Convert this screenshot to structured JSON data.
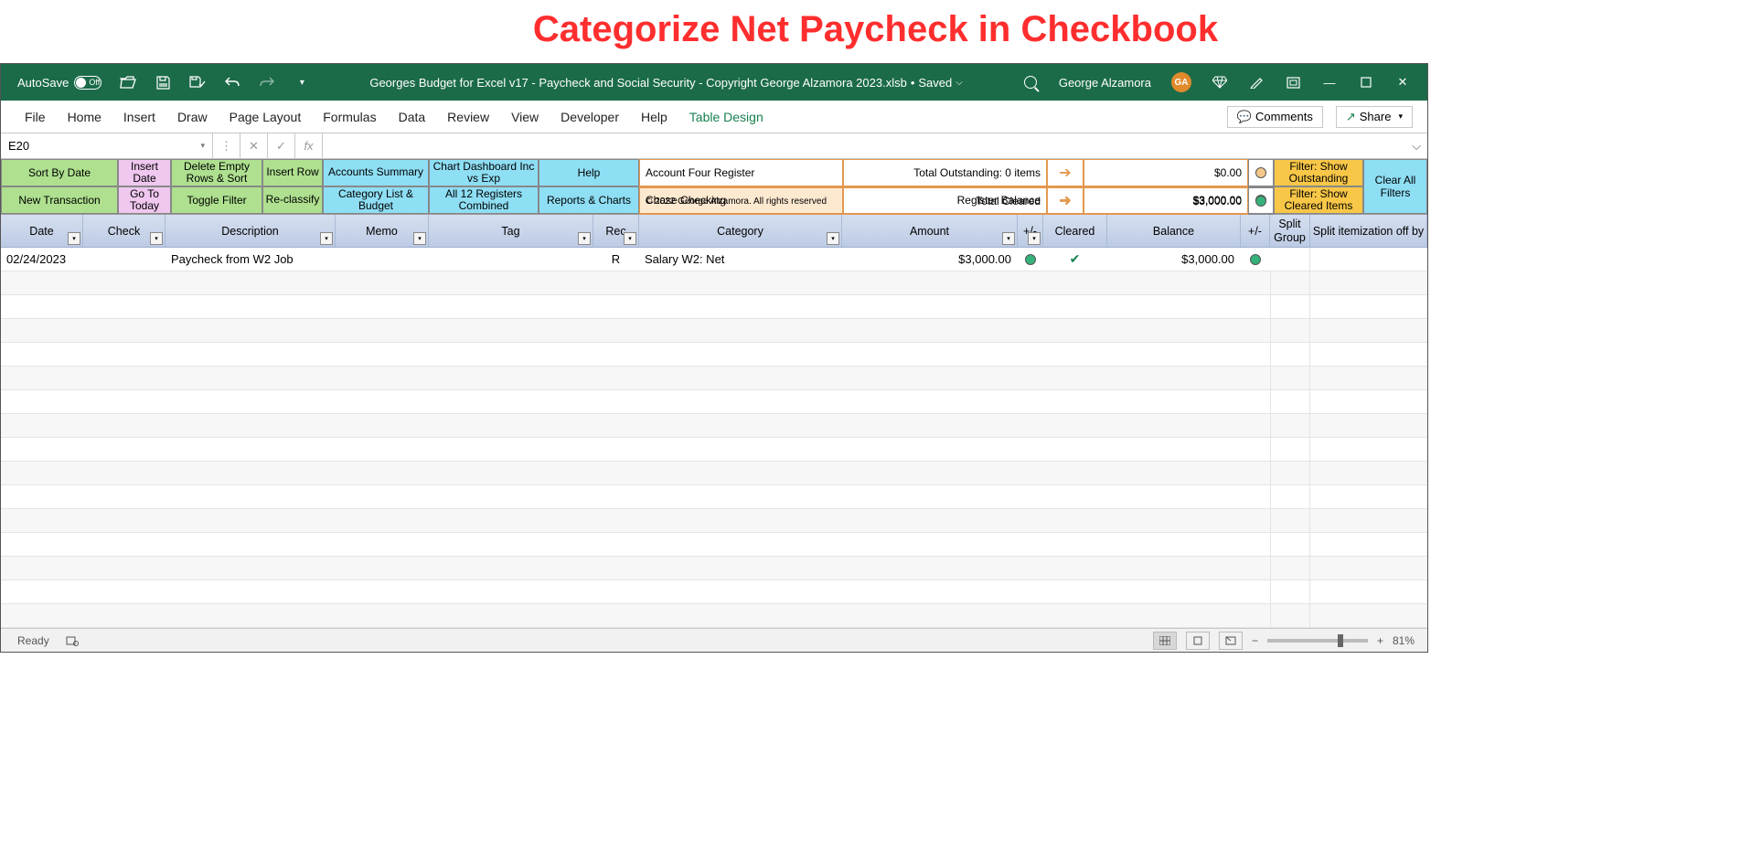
{
  "page_heading": "Categorize Net Paycheck in Checkbook",
  "titlebar": {
    "autosave": "AutoSave",
    "autosave_state": "Off",
    "filename": "Georges Budget for Excel v17 - Paycheck and Social Security - Copyright George Alzamora 2023.xlsb",
    "save_state": "Saved",
    "user": "George Alzamora",
    "initials": "GA"
  },
  "ribbon": {
    "tabs": [
      "File",
      "Home",
      "Insert",
      "Draw",
      "Page Layout",
      "Formulas",
      "Data",
      "Review",
      "View",
      "Developer",
      "Help",
      "Table Design"
    ],
    "comments": "Comments",
    "share": "Share"
  },
  "fbar": {
    "namebox": "E20",
    "fx": "fx"
  },
  "ctool": {
    "sort_by_date": "Sort By Date",
    "new_transaction": "New Transaction",
    "insert_date": "Insert Date",
    "go_to_today": "Go To Today",
    "delete_empty": "Delete Empty Rows & Sort",
    "toggle_filter": "Toggle Filter",
    "insert_row": "Insert Row",
    "reclassify": "Re-classify",
    "accounts_summary": "Accounts Summary",
    "category_list": "Category List & Budget",
    "chart_dashboard": "Chart Dashboard Inc vs Exp",
    "all12": "All 12 Registers Combined",
    "help": "Help",
    "reports": "Reports & Charts",
    "filter_outstanding": "Filter: Show Outstanding",
    "filter_cleared": "Filter: Show Cleared Items",
    "clear_filters": "Clear All Filters"
  },
  "info": {
    "row1_a": "Account Four Register",
    "row1_b": "Total Outstanding: 0 items",
    "row1_c": "$0.00",
    "row2_a": "Chase Checking",
    "row2_b": "Register Balance",
    "row2_c": "$3,000.00",
    "row3_a": "© 2022 George Alzamora. All rights reserved",
    "row3_b": "Total Cleared",
    "row3_c": "$3,000.00"
  },
  "grid_headers": {
    "date": "Date",
    "check": "Check",
    "description": "Description",
    "memo": "Memo",
    "tag": "Tag",
    "rec": "Rec",
    "category": "Category",
    "amount": "Amount",
    "pm1": "+/-",
    "cleared": "Cleared",
    "balance": "Balance",
    "pm2": "+/-",
    "split_group": "Split Group",
    "split_item": "Split itemization off by"
  },
  "rows": [
    {
      "date": "02/24/2023",
      "check": "",
      "description": "Paycheck from W2 Job",
      "memo": "",
      "tag": "",
      "rec": "R",
      "category": "Salary W2: Net",
      "amount": "$3,000.00",
      "cleared": true,
      "balance": "$3,000.00"
    }
  ],
  "status": {
    "ready": "Ready",
    "zoom": "81%"
  }
}
